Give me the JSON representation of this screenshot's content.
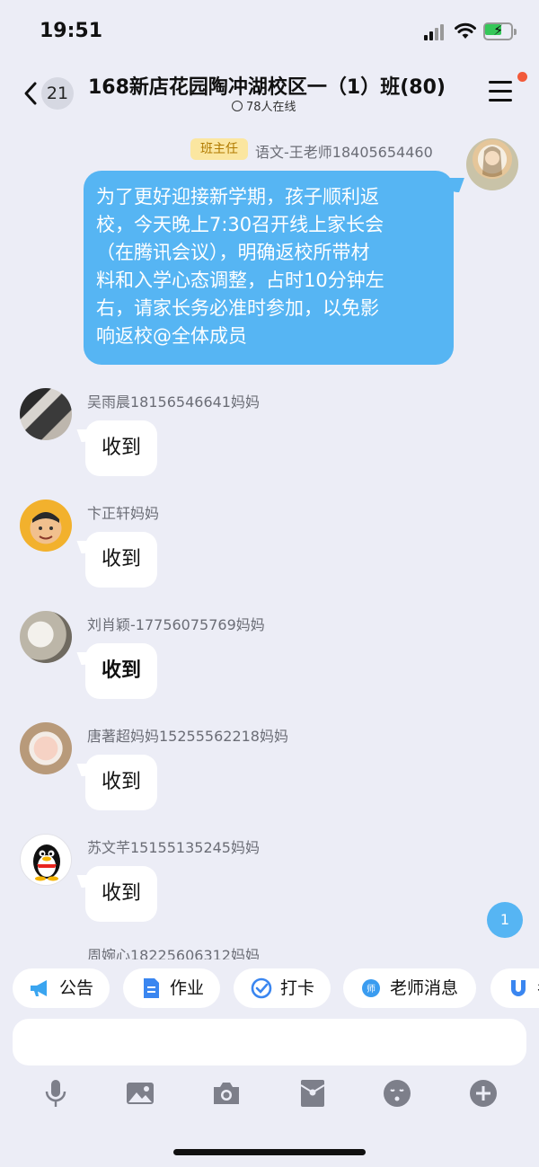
{
  "status_bar": {
    "time": "19:51"
  },
  "header": {
    "back_badge": "21",
    "title": "168新店花园陶冲湖校区一（1）班(80)",
    "online": "78人在线"
  },
  "teacher_message": {
    "role_tag": "班主任",
    "sender": "语文-王老师18405654460",
    "lines": [
      "为了更好迎接新学期，孩子顺利返",
      "校，今天晚上7:30召开线上家长会",
      "（在腾讯会议），明确返校所带材",
      "料和入学心态调整，占时10分钟左",
      "右，请家长务必准时参加，以免影",
      "响返校@全体成员"
    ]
  },
  "replies": [
    {
      "sender": "吴雨晨18156546641妈妈",
      "text": "收到"
    },
    {
      "sender": "卞正轩妈妈",
      "text": "收到"
    },
    {
      "sender": "刘肖颖-17756075769妈妈",
      "text": "收到"
    },
    {
      "sender": "唐著超妈妈15255562218妈妈",
      "text": "收到"
    },
    {
      "sender": "苏文芊15155135245妈妈",
      "text": "收到"
    },
    {
      "sender": "周婉心18225606312妈妈",
      "text": ""
    }
  ],
  "unread_count": "1",
  "tools": [
    {
      "label": "公告",
      "icon": "megaphone-icon"
    },
    {
      "label": "作业",
      "icon": "document-icon"
    },
    {
      "label": "打卡",
      "icon": "checkin-icon"
    },
    {
      "label": "老师消息",
      "icon": "teacher-icon"
    },
    {
      "label": "考",
      "icon": "magnet-icon"
    }
  ],
  "input": {
    "placeholder": ""
  },
  "toolbar": [
    "microphone-icon",
    "image-icon",
    "camera-icon",
    "red-packet-icon",
    "emoji-icon",
    "plus-icon"
  ],
  "colors": {
    "accent": "#56b5f3",
    "background": "#ecedf6",
    "tag_bg": "#fbe6a0",
    "badge_red": "#f25a3a"
  }
}
